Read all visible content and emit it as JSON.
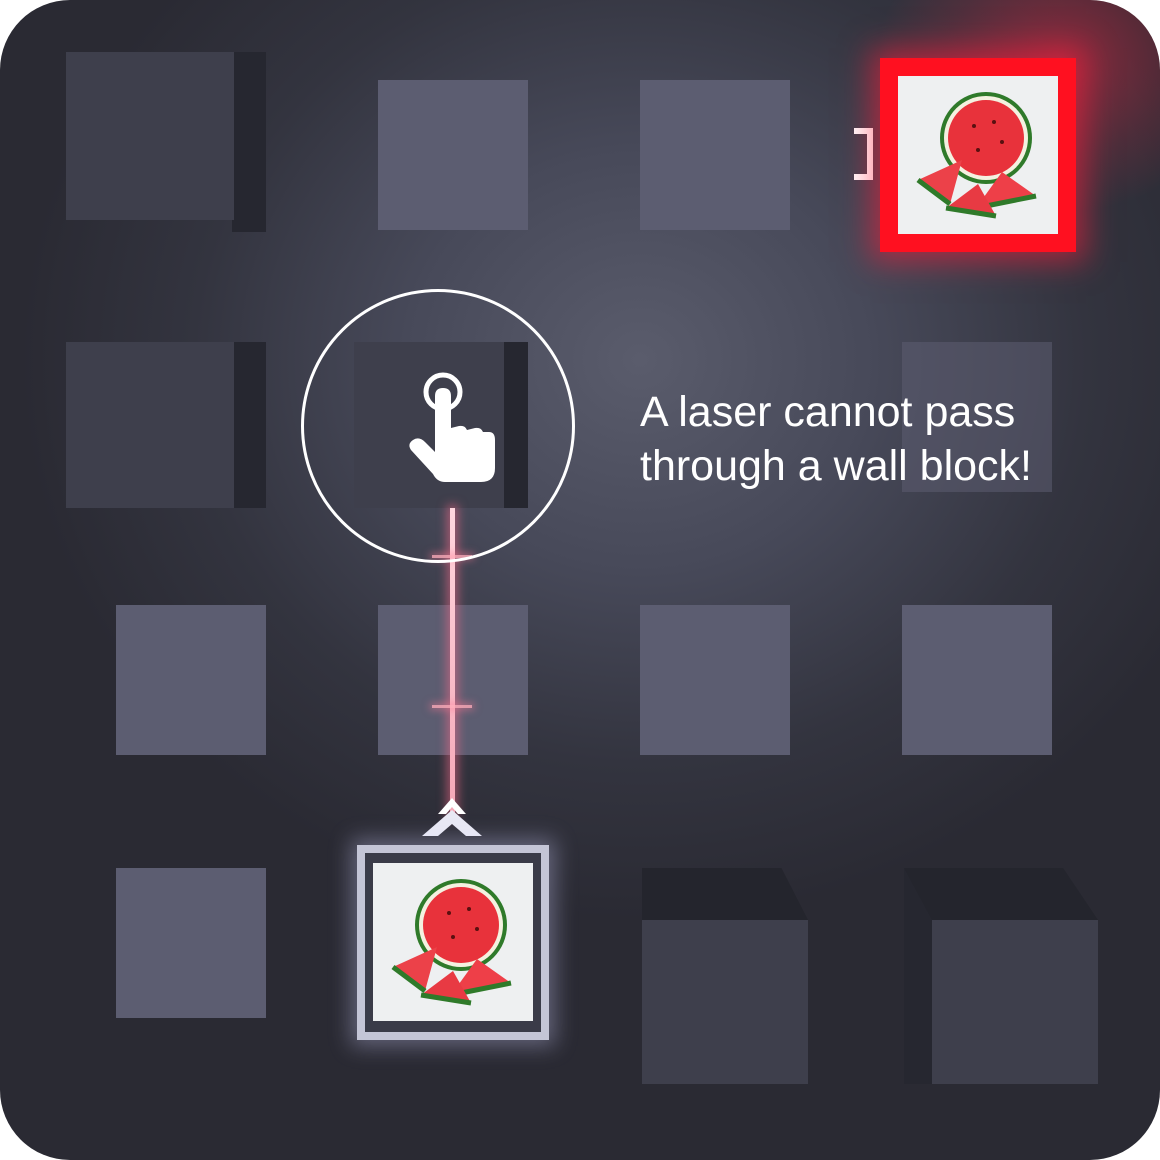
{
  "hint": {
    "line1": "A laser cannot pass",
    "line2": "through a wall block!"
  },
  "colors": {
    "board_background": "#474959",
    "floor_tile": "#5c5d71",
    "wall_block": "#3e3f4c",
    "laser": "#f4a6b6",
    "target_frame_active": "#ff1020",
    "source_frame": "#c4c5d6",
    "hint_text": "#ffffff"
  },
  "icons": {
    "tap_hint": "pointing-hand-icon",
    "fruit": "watermelon-icon",
    "laser_emitter": "chevron-up-icon",
    "laser_receiver": "bracket-icon"
  }
}
